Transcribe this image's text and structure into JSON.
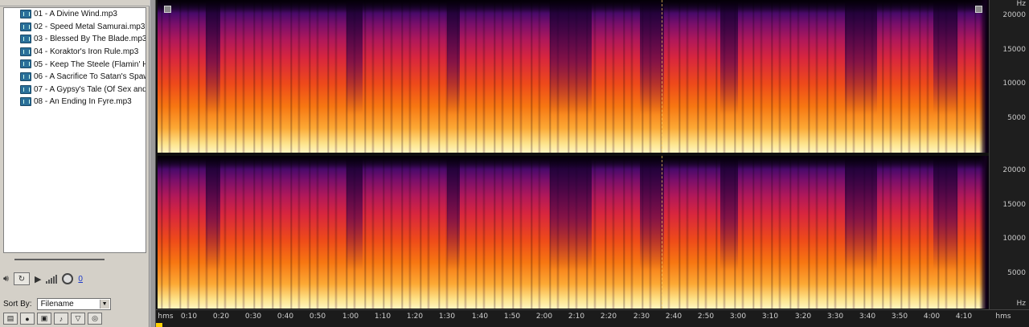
{
  "files": [
    {
      "label": "01 - A Divine Wind.mp3",
      "icon": "audio-file-icon"
    },
    {
      "label": "02 - Speed Metal Samurai.mp3",
      "icon": "audio-file-icon"
    },
    {
      "label": "03 - Blessed By The Blade.mp3",
      "icon": "audio-file-icon"
    },
    {
      "label": "04 - Koraktor's Iron Rule.mp3",
      "icon": "audio-file-icon"
    },
    {
      "label": "05 - Keep The Steele (Flamin' Ho",
      "icon": "audio-file-icon"
    },
    {
      "label": "06 - A Sacrifice To Satan's Spaw",
      "icon": "audio-file-icon"
    },
    {
      "label": "07 - A Gypsy's Tale (Of Sex and S",
      "icon": "audio-file-icon"
    },
    {
      "label": "08 - An Ending In Fyre.mp3",
      "icon": "audio-file-icon"
    }
  ],
  "controls": {
    "volume_value": "0"
  },
  "sort": {
    "label": "Sort By:",
    "value": "Filename"
  },
  "hz_axis": {
    "unit": "Hz",
    "ticks": [
      "20000",
      "15000",
      "10000",
      "5000"
    ]
  },
  "time_axis": {
    "unit_left": "hms",
    "unit_right": "hms",
    "ticks": [
      "0:10",
      "0:20",
      "0:30",
      "0:40",
      "0:50",
      "1:00",
      "1:10",
      "1:20",
      "1:30",
      "1:40",
      "1:50",
      "2:00",
      "2:10",
      "2:20",
      "2:30",
      "2:40",
      "2:50",
      "3:00",
      "3:10",
      "3:20",
      "3:30",
      "3:40",
      "3:50",
      "4:00",
      "4:10"
    ]
  },
  "colors": {
    "spectrogram_low": "#fff5c0",
    "spectrogram_mid": "#ee4a1a",
    "spectrogram_high": "#4b0a6a",
    "playhead_marker": "#ffd200",
    "volume_link": "#1b38c8"
  }
}
